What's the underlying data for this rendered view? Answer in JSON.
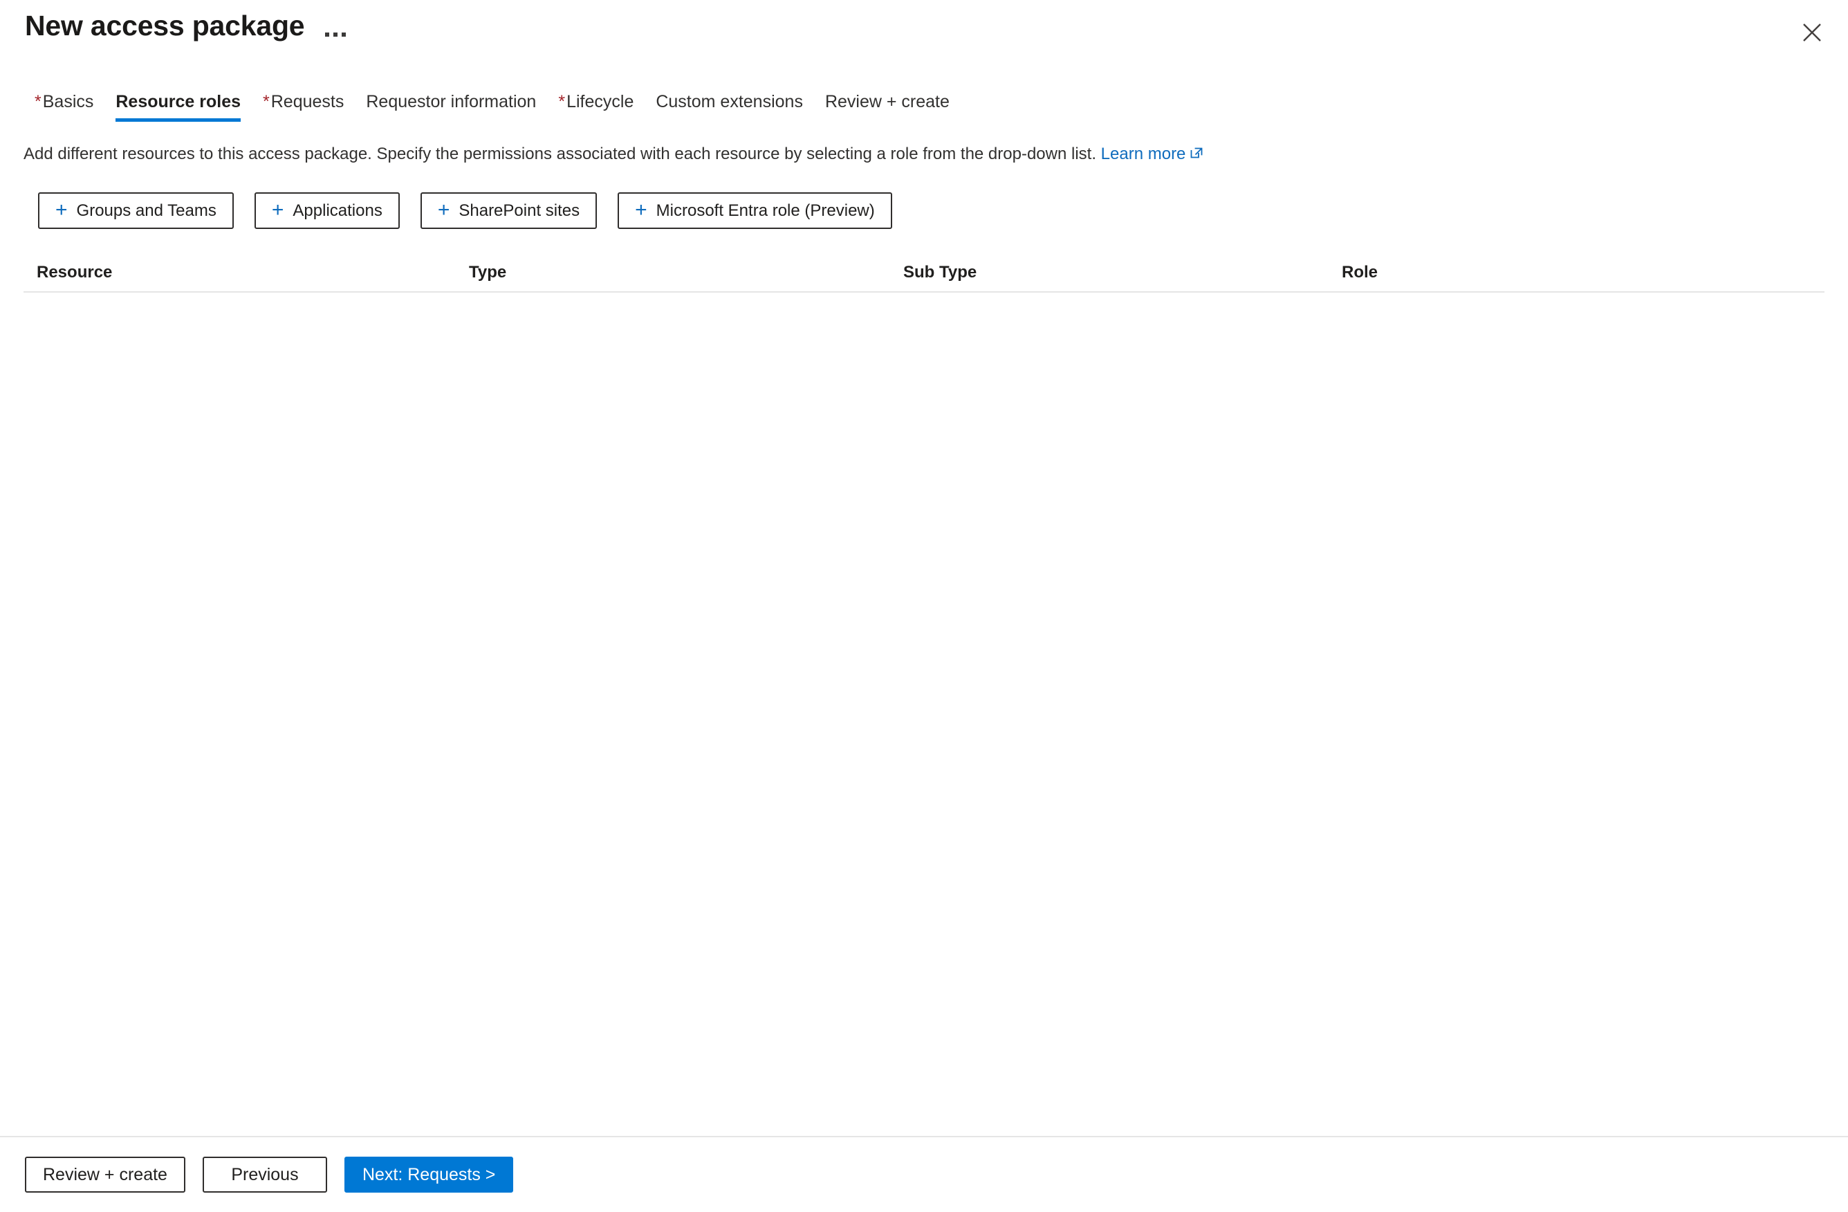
{
  "blade": {
    "title": "New access package",
    "context_menu_icon": "ellipsis-icon",
    "close_icon": "close-icon"
  },
  "tabs": [
    {
      "label": "Basics",
      "required": true,
      "active": false
    },
    {
      "label": "Resource roles",
      "required": false,
      "active": true
    },
    {
      "label": "Requests",
      "required": true,
      "active": false
    },
    {
      "label": "Requestor information",
      "required": false,
      "active": false
    },
    {
      "label": "Lifecycle",
      "required": true,
      "active": false
    },
    {
      "label": "Custom extensions",
      "required": false,
      "active": false
    },
    {
      "label": "Review + create",
      "required": false,
      "active": false
    }
  ],
  "description": {
    "text": "Add different resources to this access package. Specify the permissions associated with each resource by selecting a role from the drop-down list.",
    "link_text": "Learn more",
    "link_icon": "external-link-icon"
  },
  "commands": [
    {
      "label": "Groups and Teams",
      "icon": "plus-icon"
    },
    {
      "label": "Applications",
      "icon": "plus-icon"
    },
    {
      "label": "SharePoint sites",
      "icon": "plus-icon"
    },
    {
      "label": "Microsoft Entra role (Preview)",
      "icon": "plus-icon"
    }
  ],
  "table": {
    "columns": [
      "Resource",
      "Type",
      "Sub Type",
      "Role"
    ],
    "rows": []
  },
  "footer": {
    "review_create_label": "Review + create",
    "previous_label": "Previous",
    "next_label": "Next: Requests >"
  },
  "colors": {
    "accent": "#0078d4",
    "link": "#0f6cbd",
    "required_asterisk": "#a4262c",
    "border": "#302e2d",
    "divider": "#e5e5e5"
  }
}
